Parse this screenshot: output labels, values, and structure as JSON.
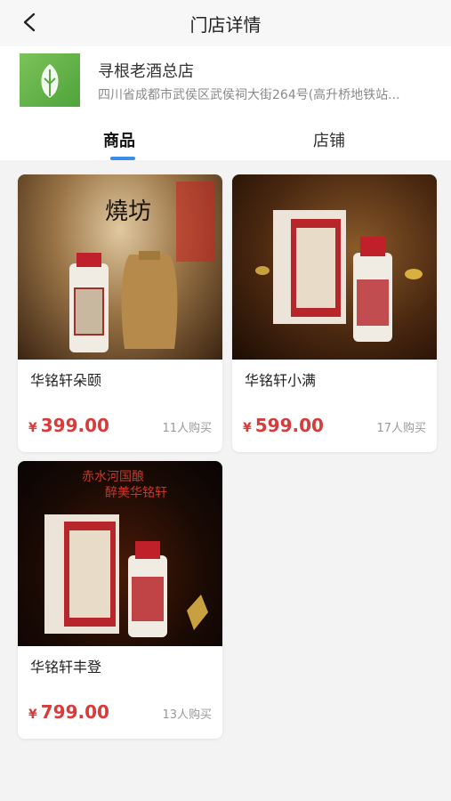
{
  "header": {
    "title": "门店详情"
  },
  "store": {
    "name": "寻根老酒总店",
    "address": "四川省成都市武侯区武侯祠大街264号(高升桥地铁站..."
  },
  "tabs": [
    {
      "label": "商品"
    },
    {
      "label": "店铺"
    }
  ],
  "products": [
    {
      "name": "华铭轩朵颐",
      "currency": "¥",
      "price": "399.00",
      "sold": "11人购买"
    },
    {
      "name": "华铭轩小满",
      "currency": "¥",
      "price": "599.00",
      "sold": "17人购买"
    },
    {
      "name": "华铭轩丰登",
      "currency": "¥",
      "price": "799.00",
      "sold": "13人购买"
    }
  ],
  "image_texts": {
    "p1_title": "燒坊",
    "p3_slogan_1": "赤水河国酿",
    "p3_slogan_2": "醉美华铭轩"
  },
  "colors": {
    "accent": "#3a8ee6",
    "price": "#d83b3b"
  }
}
